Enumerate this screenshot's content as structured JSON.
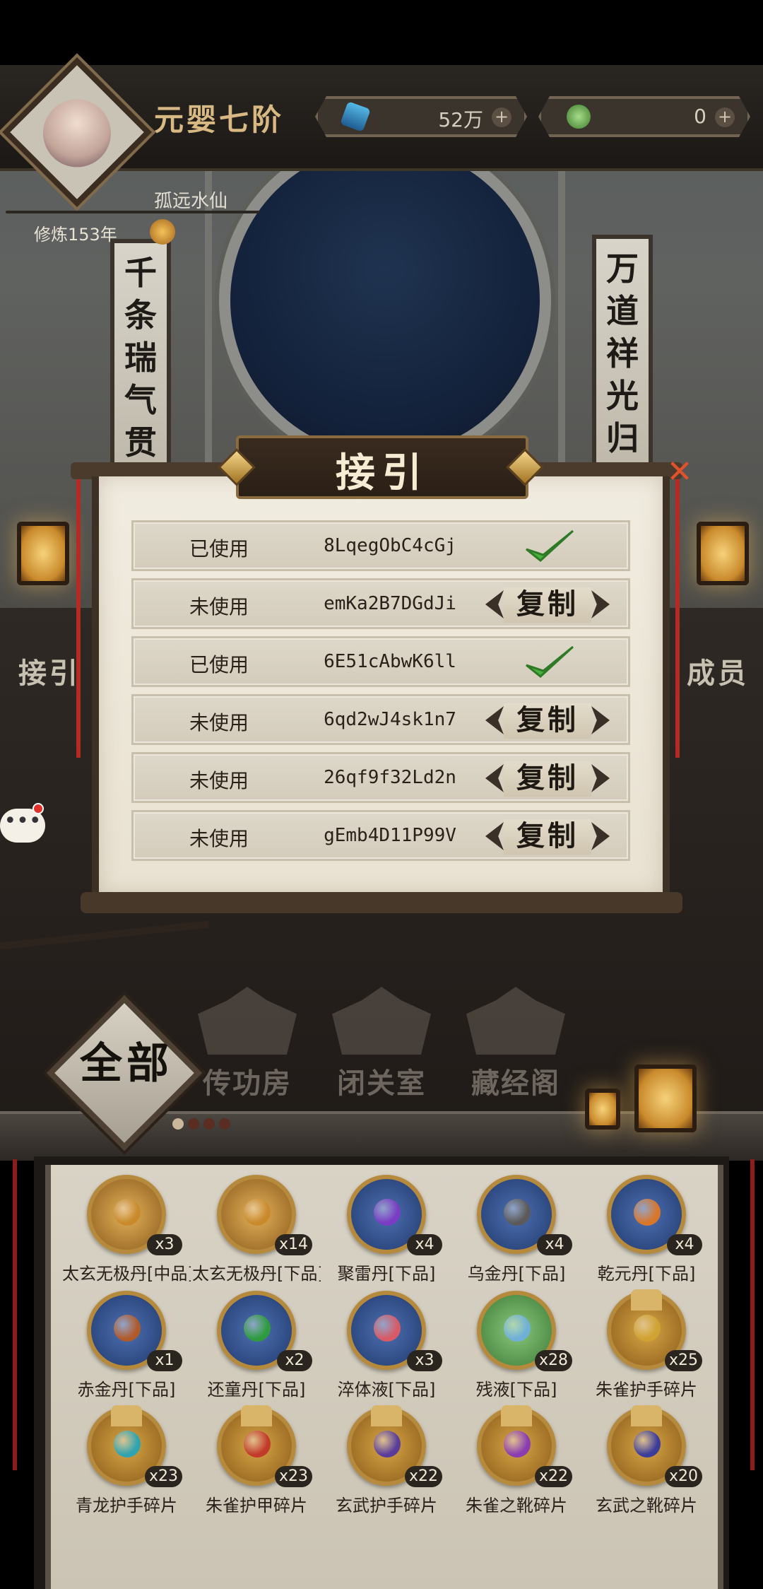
{
  "header": {
    "rank_title": "元婴七阶",
    "currencies": [
      {
        "icon": "spirit-stone-icon",
        "amount": "52万"
      },
      {
        "icon": "jade-icon",
        "amount": "0"
      }
    ],
    "player_name": "孤远水仙",
    "cultivation": "修炼153年"
  },
  "scene": {
    "couplet_left": [
      "千",
      "条",
      "瑞",
      "气",
      "贯",
      "★"
    ],
    "couplet_right": [
      "万",
      "道",
      "祥",
      "光",
      "归",
      "★"
    ],
    "side_left": "接引",
    "side_right": "成员"
  },
  "modal": {
    "title": "接引",
    "codes": [
      {
        "status": "已使用",
        "code": "8LqegObC4cGj",
        "action": "check"
      },
      {
        "status": "未使用",
        "code": "emKa2B7DGdJi",
        "action": "复制"
      },
      {
        "status": "已使用",
        "code": "6E51cAbwK6ll",
        "action": "check"
      },
      {
        "status": "未使用",
        "code": "6qd2wJ4sk1n7",
        "action": "复制"
      },
      {
        "status": "未使用",
        "code": "26qf9f32Ld2n",
        "action": "复制"
      },
      {
        "status": "未使用",
        "code": "gEmb4D11P99V",
        "action": "复制"
      }
    ]
  },
  "chat": {
    "icon": "chat-bubble-icon",
    "text": "•••"
  },
  "tabs": {
    "all": "全部",
    "buildings": [
      "传功房",
      "闭关室",
      "藏经阁"
    ]
  },
  "inventory": {
    "items": [
      {
        "name": "太玄无极丹[中品]",
        "count": "x3",
        "color": "#c98a2c"
      },
      {
        "name": "太玄无极丹[下品]",
        "count": "x14",
        "color": "#c98a2c"
      },
      {
        "name": "聚雷丹[下品]",
        "count": "x4",
        "color": "#7a3cc4"
      },
      {
        "name": "乌金丹[下品]",
        "count": "x4",
        "color": "#5c5a58"
      },
      {
        "name": "乾元丹[下品]",
        "count": "x4",
        "color": "#d9762a"
      },
      {
        "name": "赤金丹[下品]",
        "count": "x1",
        "color": "#b05a2a"
      },
      {
        "name": "还童丹[下品]",
        "count": "x2",
        "color": "#2e9c3e"
      },
      {
        "name": "淬体液[下品]",
        "count": "x3",
        "color": "#d85a66"
      },
      {
        "name": "残液[下品]",
        "count": "x28",
        "color": "#6fb0d8"
      },
      {
        "name": "朱雀护手碎片",
        "count": "x25",
        "color": "#d0a231"
      },
      {
        "name": "青龙护手碎片",
        "count": "x23",
        "color": "#2fa4b0"
      },
      {
        "name": "朱雀护甲碎片",
        "count": "x23",
        "color": "#c23a2a"
      },
      {
        "name": "玄武护手碎片",
        "count": "x22",
        "color": "#5a3c9a"
      },
      {
        "name": "朱雀之靴碎片",
        "count": "x22",
        "color": "#8a3cb0"
      },
      {
        "name": "玄武之靴碎片",
        "count": "x20",
        "color": "#3c3c9a"
      }
    ]
  }
}
